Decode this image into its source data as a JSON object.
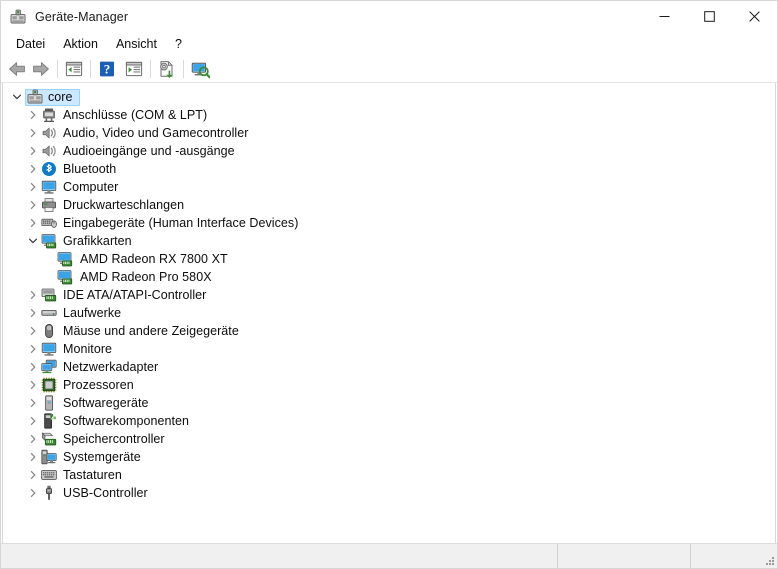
{
  "window": {
    "title": "Geräte-Manager",
    "icon": "device-manager-icon",
    "controls": {
      "minimize_label": "Minimieren",
      "maximize_label": "Maximieren",
      "close_label": "Schließen"
    }
  },
  "menubar": {
    "items": [
      {
        "label": "Datei",
        "name": "menu-datei"
      },
      {
        "label": "Aktion",
        "name": "menu-aktion"
      },
      {
        "label": "Ansicht",
        "name": "menu-ansicht"
      },
      {
        "label": "?",
        "name": "menu-hilfe"
      }
    ]
  },
  "toolbar": {
    "buttons": [
      {
        "icon": "back-arrow-icon",
        "tooltip": "Zurück"
      },
      {
        "icon": "forward-arrow-icon",
        "tooltip": "Vorwärts"
      },
      {
        "icon": "properties-icon",
        "tooltip": "Eigenschaften"
      },
      {
        "icon": "help-icon",
        "tooltip": "Hilfe"
      },
      {
        "icon": "scan-hardware-changes-icon",
        "tooltip": "Nach geänderter Hardware suchen"
      },
      {
        "icon": "update-driver-icon",
        "tooltip": "Treiber aktualisieren"
      },
      {
        "icon": "show-hidden-devices-icon",
        "tooltip": "Ausgeblendete Geräte anzeigen"
      }
    ]
  },
  "tree": {
    "root": {
      "label": "core",
      "icon": "computer-root-icon",
      "expanded": true,
      "selected": true
    },
    "nodes": [
      {
        "label": "Anschlüsse (COM & LPT)",
        "icon": "ports-icon",
        "expanded": false,
        "level": 1
      },
      {
        "label": "Audio, Video und Gamecontroller",
        "icon": "speaker-icon",
        "expanded": false,
        "level": 1
      },
      {
        "label": "Audioeingänge und -ausgänge",
        "icon": "speaker-icon",
        "expanded": false,
        "level": 1
      },
      {
        "label": "Bluetooth",
        "icon": "bluetooth-icon",
        "expanded": false,
        "level": 1
      },
      {
        "label": "Computer",
        "icon": "monitor-icon",
        "expanded": false,
        "level": 1
      },
      {
        "label": "Druckwarteschlangen",
        "icon": "printer-icon",
        "expanded": false,
        "level": 1
      },
      {
        "label": "Eingabegeräte (Human Interface Devices)",
        "icon": "hid-icon",
        "expanded": false,
        "level": 1
      },
      {
        "label": "Grafikkarten",
        "icon": "display-adapter-icon",
        "expanded": true,
        "level": 1
      },
      {
        "label": "AMD  Radeon RX 7800 XT",
        "icon": "display-adapter-icon",
        "level": 2
      },
      {
        "label": "AMD Radeon Pro 580X",
        "icon": "display-adapter-icon",
        "level": 2
      },
      {
        "label": "IDE ATA/ATAPI-Controller",
        "icon": "ide-controller-icon",
        "expanded": false,
        "level": 1
      },
      {
        "label": "Laufwerke",
        "icon": "disk-drive-icon",
        "expanded": false,
        "level": 1
      },
      {
        "label": "Mäuse und andere Zeigegeräte",
        "icon": "mouse-icon",
        "expanded": false,
        "level": 1
      },
      {
        "label": "Monitore",
        "icon": "monitor-icon",
        "expanded": false,
        "level": 1
      },
      {
        "label": "Netzwerkadapter",
        "icon": "network-adapter-icon",
        "expanded": false,
        "level": 1
      },
      {
        "label": "Prozessoren",
        "icon": "processor-icon",
        "expanded": false,
        "level": 1
      },
      {
        "label": "Softwaregeräte",
        "icon": "software-device-icon",
        "expanded": false,
        "level": 1
      },
      {
        "label": "Softwarekomponenten",
        "icon": "software-component-icon",
        "expanded": false,
        "level": 1
      },
      {
        "label": "Speichercontroller",
        "icon": "storage-controller-icon",
        "expanded": false,
        "level": 1
      },
      {
        "label": "Systemgeräte",
        "icon": "system-device-icon",
        "expanded": false,
        "level": 1
      },
      {
        "label": "Tastaturen",
        "icon": "keyboard-icon",
        "expanded": false,
        "level": 1
      },
      {
        "label": "USB-Controller",
        "icon": "usb-controller-icon",
        "expanded": false,
        "level": 1
      }
    ]
  },
  "statusbar": {
    "main_text": "",
    "mid_text": "",
    "end_text": ""
  },
  "colors": {
    "selection_fill": "#cce8ff",
    "selection_border": "#99d1ff",
    "accent_blue": "#0078d7",
    "bluetooth_blue": "#1279c6",
    "device_green": "#3d8a35",
    "window_bg": "#ffffff",
    "statusbar_bg": "#f0f0f0"
  }
}
